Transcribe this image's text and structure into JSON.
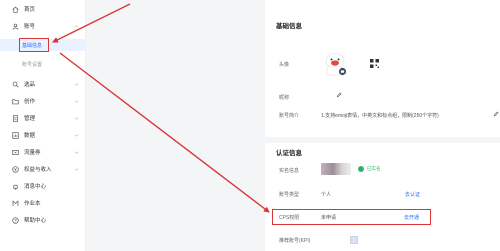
{
  "sidebar": {
    "items": [
      {
        "label": "首页",
        "icon": "home-icon"
      },
      {
        "label": "账号",
        "icon": "user-icon"
      },
      {
        "label": "基础信息",
        "icon": ""
      },
      {
        "label": "账号设置",
        "icon": ""
      },
      {
        "label": "选品",
        "icon": "search-icon"
      },
      {
        "label": "创作",
        "icon": "folder-icon"
      },
      {
        "label": "管理",
        "icon": "file-icon"
      },
      {
        "label": "数据",
        "icon": "chart-icon"
      },
      {
        "label": "流量券",
        "icon": "ticket-icon"
      },
      {
        "label": "权益与收入",
        "icon": "money-icon"
      },
      {
        "label": "消息中心",
        "icon": "bell-icon"
      },
      {
        "label": "作业本",
        "icon": "mail-icon"
      },
      {
        "label": "帮助中心",
        "icon": "help-icon"
      }
    ]
  },
  "basic_info": {
    "title": "基础信息",
    "avatar_label": "头像",
    "nickname_label": "昵称",
    "bio_label": "账号简介",
    "bio_value": "1.支持emoji表情，中英文和标点组，限制(250个字符)"
  },
  "auth_info": {
    "title": "认证信息",
    "real_name_label": "实名信息",
    "real_name_status": "已实名",
    "account_type_label": "账号类型",
    "account_type_value": "个人",
    "account_type_action": "去认证",
    "cps_label": "CPS权限",
    "cps_value": "未申请",
    "cps_action": "去开通",
    "bottom_label": "推荐账号(KPI)"
  },
  "colors": {
    "accent": "#2f6bff",
    "annotation_red": "#d93636",
    "verified_green": "#2fb36b"
  }
}
